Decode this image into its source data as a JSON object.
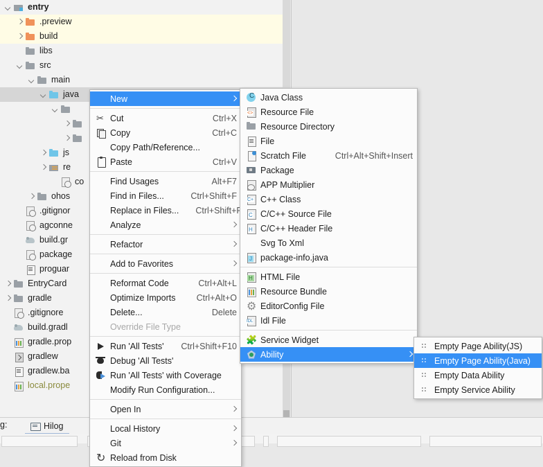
{
  "tree": {
    "items": [
      {
        "indent": 0,
        "arrow": "down",
        "icon": "module-icon",
        "label": "entry",
        "bold": true,
        "row": "sel-light"
      },
      {
        "indent": 1,
        "arrow": "right",
        "icon": "folder-orange-icon",
        "label": ".preview",
        "row": "hl-yellow"
      },
      {
        "indent": 1,
        "arrow": "right",
        "icon": "folder-orange-icon",
        "label": "build",
        "row": "hl-yellow"
      },
      {
        "indent": 1,
        "arrow": "none",
        "icon": "folder-icon",
        "label": "libs",
        "row": ""
      },
      {
        "indent": 1,
        "arrow": "down",
        "icon": "folder-icon",
        "label": "src",
        "row": ""
      },
      {
        "indent": 2,
        "arrow": "down",
        "icon": "folder-icon",
        "label": "main",
        "row": ""
      },
      {
        "indent": 3,
        "arrow": "down",
        "icon": "folder-blue-icon",
        "label": "java",
        "row": "hl-sel"
      },
      {
        "indent": 4,
        "arrow": "down",
        "icon": "folder-icon",
        "label": "",
        "row": ""
      },
      {
        "indent": 5,
        "arrow": "right",
        "icon": "folder-icon",
        "label": "",
        "row": ""
      },
      {
        "indent": 5,
        "arrow": "right",
        "icon": "folder-icon",
        "label": "",
        "row": ""
      },
      {
        "indent": 3,
        "arrow": "right",
        "icon": "folder-blue-icon",
        "label": "js",
        "row": ""
      },
      {
        "indent": 3,
        "arrow": "right",
        "icon": "folder-res-icon",
        "label": "re",
        "row": ""
      },
      {
        "indent": 4,
        "arrow": "none",
        "icon": "file-badge-icon",
        "label": "co",
        "row": ""
      },
      {
        "indent": 2,
        "arrow": "right",
        "icon": "folder-icon",
        "label": "ohos",
        "row": ""
      },
      {
        "indent": 1,
        "arrow": "none",
        "icon": "file-badge-icon",
        "label": ".gitignor",
        "row": ""
      },
      {
        "indent": 1,
        "arrow": "none",
        "icon": "file-badge-icon",
        "label": "agconne",
        "row": ""
      },
      {
        "indent": 1,
        "arrow": "none",
        "icon": "gradle-icon",
        "label": "build.gr",
        "row": ""
      },
      {
        "indent": 1,
        "arrow": "none",
        "icon": "file-badge-icon",
        "label": "package",
        "row": ""
      },
      {
        "indent": 1,
        "arrow": "none",
        "icon": "file-icon",
        "label": "proguar",
        "row": ""
      },
      {
        "indent": 0,
        "arrow": "right",
        "icon": "folder-icon",
        "label": "EntryCard",
        "row": ""
      },
      {
        "indent": 0,
        "arrow": "right",
        "icon": "folder-icon",
        "label": "gradle",
        "row": ""
      },
      {
        "indent": 0,
        "arrow": "none",
        "icon": "file-badge-icon",
        "label": ".gitignore",
        "row": ""
      },
      {
        "indent": 0,
        "arrow": "none",
        "icon": "gradle-icon",
        "label": "build.gradl",
        "row": ""
      },
      {
        "indent": 0,
        "arrow": "none",
        "icon": "props-icon",
        "label": "gradle.prop",
        "row": ""
      },
      {
        "indent": 0,
        "arrow": "none",
        "icon": "script-icon",
        "label": "gradlew",
        "row": ""
      },
      {
        "indent": 0,
        "arrow": "none",
        "icon": "file-icon",
        "label": "gradlew.ba",
        "row": ""
      },
      {
        "indent": 0,
        "arrow": "none",
        "icon": "props-icon",
        "label": "local.prope",
        "row": "",
        "olive": true
      }
    ]
  },
  "bottom": {
    "log_prefix": "g:",
    "hilog_tab": "Hilog"
  },
  "context_menu": {
    "items": [
      {
        "label": "New",
        "accel": "",
        "submenu": true,
        "selected": true,
        "icon": "",
        "mnemonic": "N"
      },
      {
        "sep": true
      },
      {
        "label": "Cut",
        "accel": "Ctrl+X",
        "icon": "scissors-icon",
        "mnemonic": "t"
      },
      {
        "label": "Copy",
        "accel": "Ctrl+C",
        "icon": "copy-icon",
        "mnemonic": "C"
      },
      {
        "label": "Copy Path/Reference...",
        "accel": "",
        "icon": ""
      },
      {
        "label": "Paste",
        "accel": "Ctrl+V",
        "icon": "paste-icon",
        "mnemonic": "P"
      },
      {
        "sep": true
      },
      {
        "label": "Find Usages",
        "accel": "Alt+F7",
        "icon": "",
        "mnemonic": "U"
      },
      {
        "label": "Find in Files...",
        "accel": "Ctrl+Shift+F",
        "icon": ""
      },
      {
        "label": "Replace in Files...",
        "accel": "Ctrl+Shift+R",
        "icon": "",
        "mnemonic": "a"
      },
      {
        "label": "Analyze",
        "accel": "",
        "submenu": true,
        "icon": "",
        "mnemonic": "y"
      },
      {
        "sep": true
      },
      {
        "label": "Refactor",
        "accel": "",
        "submenu": true,
        "icon": "",
        "mnemonic": "R"
      },
      {
        "sep": true
      },
      {
        "label": "Add to Favorites",
        "accel": "",
        "submenu": true,
        "icon": "",
        "mnemonic": "v"
      },
      {
        "sep": true
      },
      {
        "label": "Reformat Code",
        "accel": "Ctrl+Alt+L",
        "icon": "",
        "mnemonic": "R"
      },
      {
        "label": "Optimize Imports",
        "accel": "Ctrl+Alt+O",
        "icon": "",
        "mnemonic": "z"
      },
      {
        "label": "Delete...",
        "accel": "Delete",
        "icon": "",
        "mnemonic": "D"
      },
      {
        "label": "Override File Type",
        "accel": "",
        "icon": "",
        "disabled": true
      },
      {
        "sep": true
      },
      {
        "label": "Run 'All Tests'",
        "accel": "Ctrl+Shift+F10",
        "icon": "run-icon",
        "mnemonic": "u"
      },
      {
        "label": "Debug 'All Tests'",
        "accel": "",
        "icon": "debug-icon",
        "mnemonic": "D"
      },
      {
        "label": "Run 'All Tests' with Coverage",
        "accel": "",
        "icon": "coverage-icon",
        "mnemonic": "v"
      },
      {
        "label": "Modify Run Configuration...",
        "accel": "",
        "icon": ""
      },
      {
        "sep": true
      },
      {
        "label": "Open In",
        "accel": "",
        "submenu": true,
        "icon": ""
      },
      {
        "sep": true
      },
      {
        "label": "Local History",
        "accel": "",
        "submenu": true,
        "icon": "",
        "mnemonic": "H"
      },
      {
        "label": "Git",
        "accel": "",
        "submenu": true,
        "icon": "",
        "mnemonic": "G"
      },
      {
        "label": "Reload from Disk",
        "accel": "",
        "icon": "reload-icon"
      }
    ]
  },
  "new_submenu": {
    "items": [
      {
        "label": "Java Class",
        "accel": "",
        "icon": "java-class-icon"
      },
      {
        "label": "Resource File",
        "accel": "",
        "icon": "resource-file-icon"
      },
      {
        "label": "Resource Directory",
        "accel": "",
        "icon": "resource-directory-icon"
      },
      {
        "label": "File",
        "accel": "",
        "icon": "file-icon"
      },
      {
        "label": "Scratch File",
        "accel": "Ctrl+Alt+Shift+Insert",
        "icon": "scratch-file-icon"
      },
      {
        "label": "Package",
        "accel": "",
        "icon": "package-icon"
      },
      {
        "label": "APP Multiplier",
        "accel": "",
        "icon": "app-multiplier-icon"
      },
      {
        "label": "C++ Class",
        "accel": "",
        "icon": "cpp-class-icon"
      },
      {
        "label": "C/C++ Source File",
        "accel": "",
        "icon": "c-source-file-icon"
      },
      {
        "label": "C/C++ Header File",
        "accel": "",
        "icon": "c-header-file-icon"
      },
      {
        "label": "Svg To Xml",
        "accel": "",
        "icon": ""
      },
      {
        "label": "package-info.java",
        "accel": "",
        "icon": "package-info-icon"
      },
      {
        "sep": true
      },
      {
        "label": "HTML File",
        "accel": "",
        "icon": "html-file-icon"
      },
      {
        "label": "Resource Bundle",
        "accel": "",
        "icon": "resource-bundle-icon"
      },
      {
        "label": "EditorConfig File",
        "accel": "",
        "icon": "gear-icon"
      },
      {
        "label": "Idl File",
        "accel": "",
        "icon": "idl-file-icon"
      },
      {
        "sep": true
      },
      {
        "label": "Service Widget",
        "accel": "",
        "icon": "service-widget-icon"
      },
      {
        "label": "Ability",
        "accel": "",
        "icon": "ability-icon",
        "submenu": true,
        "selected": true
      }
    ]
  },
  "ability_submenu": {
    "items": [
      {
        "label": "Empty Page Ability(JS)",
        "icon": "ability-item-icon"
      },
      {
        "label": "Empty Page Ability(Java)",
        "icon": "ability-item-icon",
        "selected": true
      },
      {
        "label": "Empty Data Ability",
        "icon": "ability-item-icon"
      },
      {
        "label": "Empty Service Ability",
        "icon": "ability-item-icon"
      }
    ]
  },
  "colors": {
    "menu_highlight": "#3690f5",
    "tree_highlight_yellow": "#fffce5",
    "tree_selection": "#d6d6d6",
    "panel_background": "#f2f2f2",
    "editor_background": "#e8e8e8"
  }
}
